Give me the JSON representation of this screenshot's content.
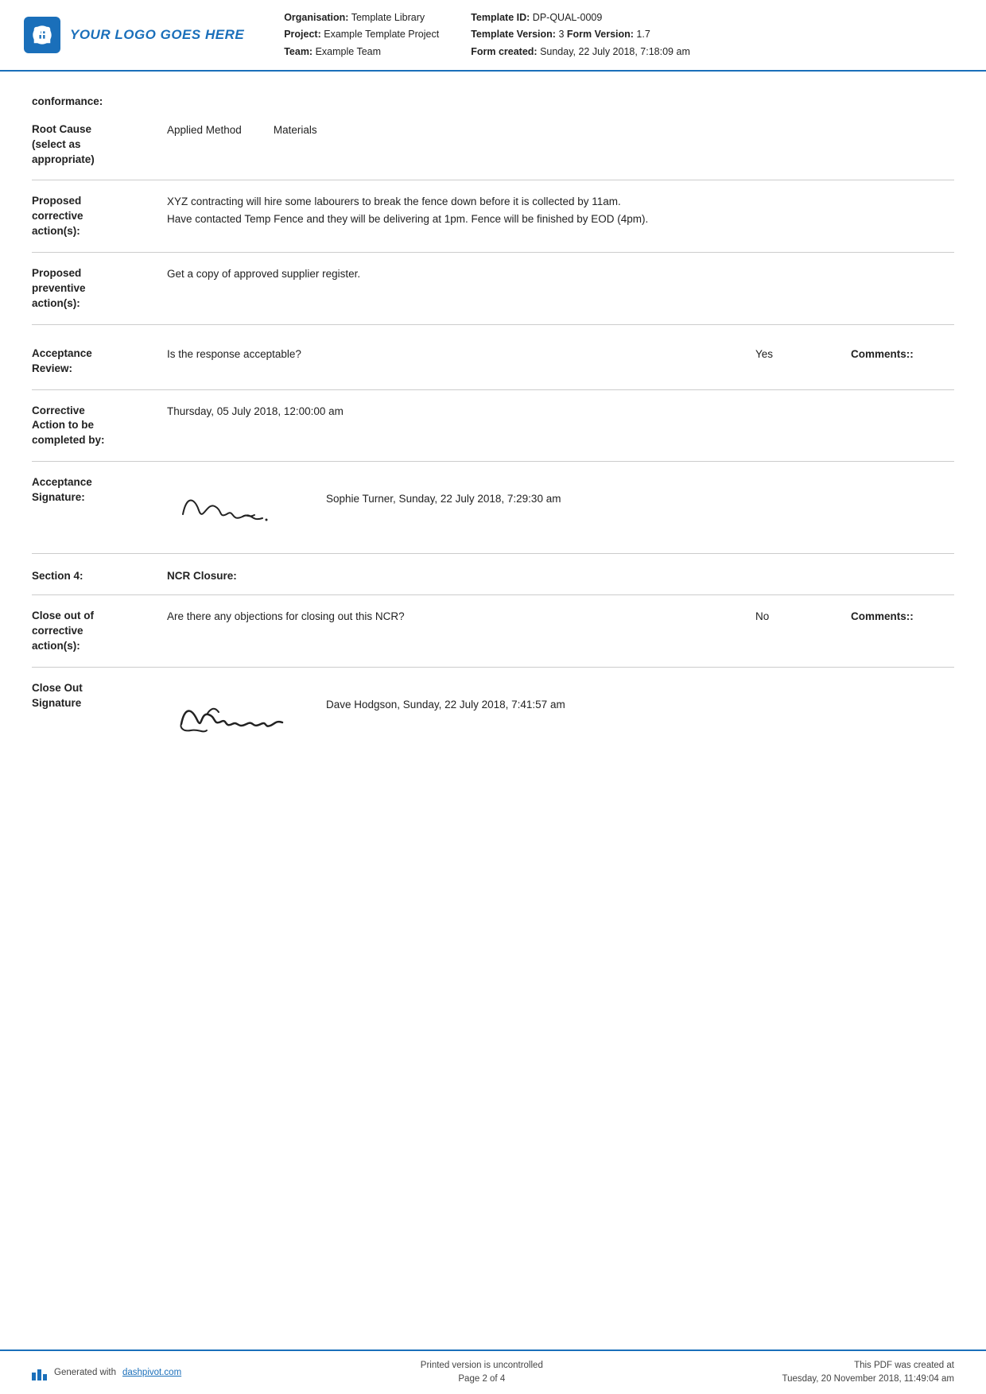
{
  "header": {
    "logo_text": "YOUR LOGO GOES HERE",
    "org_label": "Organisation:",
    "org_value": "Template Library",
    "project_label": "Project:",
    "project_value": "Example Template Project",
    "team_label": "Team:",
    "team_value": "Example Team",
    "template_id_label": "Template ID:",
    "template_id_value": "DP-QUAL-0009",
    "template_version_label": "Template Version:",
    "template_version_value": "3",
    "form_version_label": "Form Version:",
    "form_version_value": "1.7",
    "form_created_label": "Form created:",
    "form_created_value": "Sunday, 22 July 2018, 7:18:09 am"
  },
  "content": {
    "conformance_label": "conformance:",
    "root_cause_label": "Root Cause\n(select as\nappropriate)",
    "root_cause_values": [
      "Applied Method",
      "Materials"
    ],
    "proposed_corrective_label": "Proposed\ncorrective\naction(s):",
    "proposed_corrective_line1": "XYZ contracting will hire some labourers to break the fence down before it is collected by 11am.",
    "proposed_corrective_line2": "Have contacted Temp Fence and they will be delivering at 1pm. Fence will be finished by EOD (4pm).",
    "proposed_preventive_label": "Proposed\npreventive\naction(s):",
    "proposed_preventive_value": "Get a copy of approved supplier register.",
    "acceptance_review_label": "Acceptance\nReview:",
    "acceptance_question": "Is the response acceptable?",
    "acceptance_answer": "Yes",
    "acceptance_comments_label": "Comments::",
    "corrective_action_label": "Corrective\nAction to be\ncompleted by:",
    "corrective_action_value": "Thursday, 05 July 2018, 12:00:00 am",
    "acceptance_signature_label": "Acceptance\nSignature:",
    "acceptance_signature_name": "Sophie Turner, Sunday, 22 July 2018, 7:29:30 am",
    "acceptance_signature_img": "Sophie",
    "section4_label": "Section 4:",
    "section4_value": "NCR Closure:",
    "close_out_label": "Close out of\ncorrective\naction(s):",
    "close_out_question": "Are there any objections for closing out this NCR?",
    "close_out_answer": "No",
    "close_out_comments_label": "Comments::",
    "close_out_signature_label": "Close Out\nSignature",
    "close_out_signature_name": "Dave Hodgson, Sunday, 22 July 2018, 7:41:57 am",
    "close_out_signature_img": "David"
  },
  "footer": {
    "generated_text": "Generated with",
    "generated_link": "dashpivot.com",
    "printed_line1": "Printed version is uncontrolled",
    "printed_line2": "Page 2 of 4",
    "pdf_line1": "This PDF was created at",
    "pdf_line2": "Tuesday, 20 November 2018, 11:49:04 am"
  }
}
